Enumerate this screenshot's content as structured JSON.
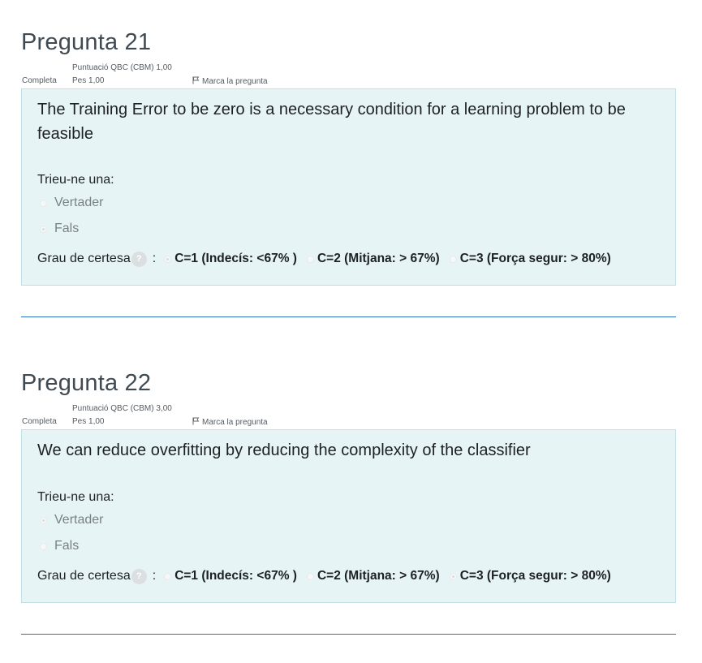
{
  "colors": {
    "accent": "#2d6ec4",
    "content_bg": "#e7f4f6",
    "content_border": "#bfe1e6",
    "divider": "#2d6ec4"
  },
  "questions": [
    {
      "title": "Pregunta 21",
      "state": "Completa",
      "score": "Puntuació QBC (CBM) 1,00",
      "weight": "Pes 1,00",
      "flag_label": "Marca la pregunta",
      "flag_icon": "flag-icon",
      "text": "The Training Error to be zero is a necessary condition for a learning problem to be feasible",
      "prompt": "Trieu-ne una:",
      "options": [
        {
          "label": "Vertader",
          "checked": false
        },
        {
          "label": "Fals",
          "checked": true
        }
      ],
      "certainty_label": "Grau de certesa",
      "help_icon": "help-icon",
      "help_glyph": "?",
      "colon": ":",
      "certainty_options": [
        {
          "label": "C=1 (Indecís: <67% )",
          "checked": true
        },
        {
          "label": "C=2 (Mitjana: > 67%)",
          "checked": false
        },
        {
          "label": "C=3 (Força segur: > 80%)",
          "checked": false
        }
      ]
    },
    {
      "title": "Pregunta 22",
      "state": "Completa",
      "score": "Puntuació QBC (CBM) 3,00",
      "weight": "Pes 1,00",
      "flag_label": "Marca la pregunta",
      "flag_icon": "flag-icon",
      "text": "We can reduce overfitting by reducing the complexity of the classifier",
      "prompt": "Trieu-ne una:",
      "options": [
        {
          "label": "Vertader",
          "checked": true
        },
        {
          "label": "Fals",
          "checked": false
        }
      ],
      "certainty_label": "Grau de certesa",
      "help_icon": "help-icon",
      "help_glyph": "?",
      "colon": ":",
      "certainty_options": [
        {
          "label": "C=1 (Indecís: <67% )",
          "checked": false
        },
        {
          "label": "C=2 (Mitjana: > 67%)",
          "checked": false
        },
        {
          "label": "C=3 (Força segur: > 80%)",
          "checked": true
        }
      ]
    }
  ]
}
